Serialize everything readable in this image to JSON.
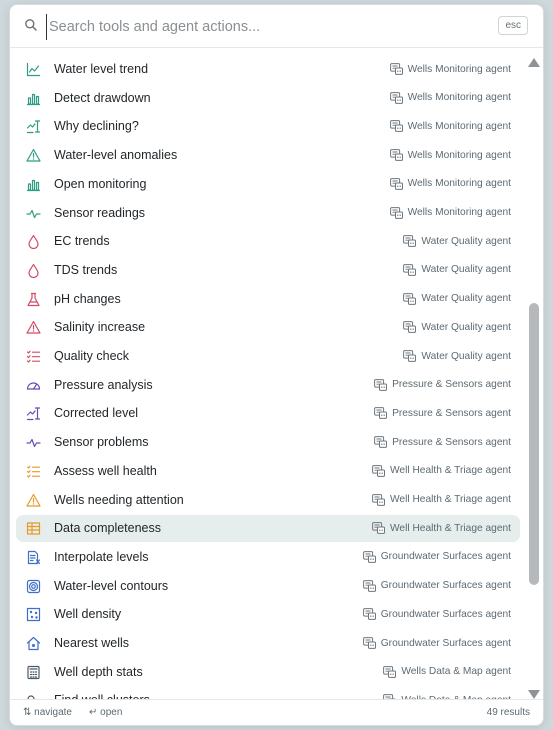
{
  "search": {
    "placeholder": "Search tools and agent actions...",
    "esc_label": "esc"
  },
  "footer": {
    "navigate": "⇅ navigate",
    "open": "↵ open",
    "count": "49 results"
  },
  "colors": {
    "wells_monitoring": "#2f9c83",
    "water_quality": "#d24a63",
    "pressure_sensors": "#6a4bb3",
    "well_health": "#e59a28",
    "groundwater_surfaces": "#3f6fc4",
    "wells_data_map": "#4d5a66"
  },
  "items": [
    {
      "label": "Water level trend",
      "agent": "Wells Monitoring agent",
      "icon": "line-chart-icon"
    },
    {
      "label": "Detect drawdown",
      "agent": "Wells Monitoring agent",
      "icon": "bar-chart-icon"
    },
    {
      "label": "Why declining?",
      "agent": "Wells Monitoring agent",
      "icon": "trend-level-icon"
    },
    {
      "label": "Water-level anomalies",
      "agent": "Wells Monitoring agent",
      "icon": "warning-icon"
    },
    {
      "label": "Open monitoring",
      "agent": "Wells Monitoring agent",
      "icon": "bar-chart-icon"
    },
    {
      "label": "Sensor readings",
      "agent": "Wells Monitoring agent",
      "icon": "pulse-icon"
    },
    {
      "label": "EC trends",
      "agent": "Water Quality agent",
      "icon": "droplet-icon"
    },
    {
      "label": "TDS trends",
      "agent": "Water Quality agent",
      "icon": "droplet-icon"
    },
    {
      "label": "pH changes",
      "agent": "Water Quality agent",
      "icon": "flask-icon"
    },
    {
      "label": "Salinity increase",
      "agent": "Water Quality agent",
      "icon": "warning-icon"
    },
    {
      "label": "Quality check",
      "agent": "Water Quality agent",
      "icon": "checklist-icon"
    },
    {
      "label": "Pressure analysis",
      "agent": "Pressure & Sensors agent",
      "icon": "gauge-icon"
    },
    {
      "label": "Corrected level",
      "agent": "Pressure & Sensors agent",
      "icon": "trend-level-icon"
    },
    {
      "label": "Sensor problems",
      "agent": "Pressure & Sensors agent",
      "icon": "pulse-icon"
    },
    {
      "label": "Assess well health",
      "agent": "Well Health & Triage agent",
      "icon": "checklist-icon"
    },
    {
      "label": "Wells needing attention",
      "agent": "Well Health & Triage agent",
      "icon": "warning-icon"
    },
    {
      "label": "Data completeness",
      "agent": "Well Health & Triage agent",
      "icon": "table-icon"
    },
    {
      "label": "Interpolate levels",
      "agent": "Groundwater Surfaces agent",
      "icon": "interpolate-icon"
    },
    {
      "label": "Water-level contours",
      "agent": "Groundwater Surfaces agent",
      "icon": "contour-icon"
    },
    {
      "label": "Well density",
      "agent": "Groundwater Surfaces agent",
      "icon": "density-grid-icon"
    },
    {
      "label": "Nearest wells",
      "agent": "Groundwater Surfaces agent",
      "icon": "house-pin-icon"
    },
    {
      "label": "Well depth stats",
      "agent": "Wells Data & Map agent",
      "icon": "calculator-icon"
    },
    {
      "label": "Find well clusters",
      "agent": "Wells Data & Map agent",
      "icon": "cluster-icon"
    }
  ]
}
